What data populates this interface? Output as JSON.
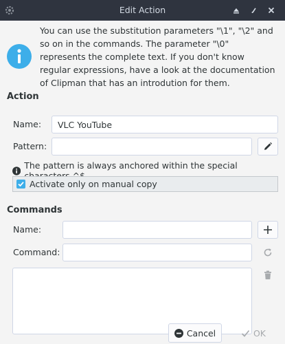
{
  "window": {
    "title": "Edit Action"
  },
  "info": {
    "text": "You can use the substitution parameters \"\\1\", \"\\2\" and so on in the commands. The parameter \"\\0\" represents the complete text. If you don't know regular expressions, have a look at the documentation of Clipman that has an introdution for them."
  },
  "action": {
    "heading": "Action",
    "name_label": "Name:",
    "name_value": "VLC YouTube",
    "pattern_label": "Pattern:",
    "pattern_value": "",
    "note": "The pattern is always anchored within the special characters ^$",
    "checkbox_label": "Activate only on manual copy",
    "checkbox_checked": true
  },
  "commands": {
    "heading": "Commands",
    "name_label": "Name:",
    "name_value": "",
    "command_label": "Command:",
    "command_value": ""
  },
  "buttons": {
    "cancel": "Cancel",
    "ok": "OK"
  },
  "colors": {
    "titlebar": "#2f343f",
    "accent": "#3daee9",
    "info_icon": "#3daee9"
  }
}
